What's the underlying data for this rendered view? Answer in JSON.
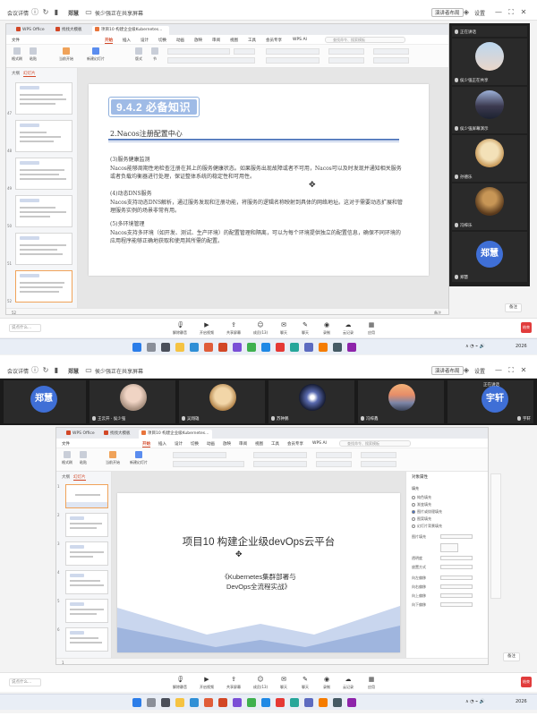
{
  "meeting": {
    "left_label": "会议详情",
    "host_name": "郑慧",
    "sharing_label": "侯少强正在共享屏幕",
    "speaker_view": "演讲者布局",
    "settings_label": "设置",
    "speaking_label": "正在讲话",
    "controls": [
      {
        "label": "解除静音",
        "icon": "mic-icon"
      },
      {
        "label": "开启视频",
        "icon": "camera-icon"
      },
      {
        "label": "共享屏幕",
        "icon": "share-icon"
      },
      {
        "label": "成员(13)",
        "icon": "members-icon"
      },
      {
        "label": "聊天",
        "icon": "chat-icon"
      },
      {
        "label": "聊天",
        "icon": "chat2-icon"
      },
      {
        "label": "应用",
        "icon": "apps-icon"
      },
      {
        "label": "录制",
        "icon": "record-icon"
      },
      {
        "label": "云记录",
        "icon": "cloud-icon"
      },
      {
        "label": "应用",
        "icon": "grid-icon"
      }
    ],
    "input_placeholder": "说点什么...",
    "end_label": "结束"
  },
  "wps": {
    "tabs": [
      "WPS Office",
      "找找大模板",
      "项目10 构建企业级Kubernetes..."
    ],
    "menus": [
      "文件",
      "开始",
      "插入",
      "设计",
      "切换",
      "动画",
      "放映",
      "审阅",
      "视图",
      "工具",
      "会员专享",
      "WPS AI"
    ],
    "active_menu": "开始",
    "search_placeholder": "查找命令、搜索模板",
    "ribbon": [
      "格式刷",
      "粘贴",
      "当前开始",
      "新建幻灯片",
      "版式",
      "节",
      "重置"
    ],
    "outline_tab": "大纲",
    "slide_tab": "幻灯片",
    "slide_numbers_1": [
      "47",
      "48",
      "49",
      "50",
      "51",
      "52"
    ],
    "slide_numbers_2": [
      "1",
      "2",
      "3",
      "4",
      "5",
      "6"
    ]
  },
  "slide1": {
    "title": "9.4.2 必备知识",
    "heading": "2.Nacos注册配置中心",
    "paragraphs": [
      {
        "head": "(3)服务健康监测",
        "body": "Nacos能够周期性地检查注册在其上的服务健康状态。如果服务出现故障或者不可用，Nacos可以及时发现并通知相关服务或者负载均衡器进行处理，保证整体系统的稳定性和可用性。"
      },
      {
        "head": "(4)动态DNS服务",
        "body": "Nacos支持动态DNS解析，通过服务发现和注册功能，将服务的逻辑名称映射到具体的网络地址。这对于需要动态扩展和管理服务实例的场景非常有用。"
      },
      {
        "head": "(5)多环境管理",
        "body": "Nacos支持多环境（如开发、测试、生产环境）的配置管理和隔离，可以为每个环境提供独立的配置信息，确保不同环境的应用程序能够正确地获取和使用其所需的配置。"
      }
    ]
  },
  "slide2": {
    "title": "项目10 构建企业级devOps云平台",
    "subtitle_line1": "《Kubernetes集群部署与",
    "subtitle_line2": "DevOps全流程实战》"
  },
  "participants_side": [
    {
      "name": "正在讲话"
    },
    {
      "name": "侯少强正在共享"
    },
    {
      "name": "侯少强屏幕演示"
    },
    {
      "name": "孙德乐"
    },
    {
      "name": "冯梓乐"
    },
    {
      "name": "郑慧"
    }
  ],
  "participants_top": [
    {
      "name": "郑慧",
      "avatar_text": "郑慧"
    },
    {
      "name": "王云开 · 侯少强"
    },
    {
      "name": "吴翔雄"
    },
    {
      "name": "苏钟鹏"
    },
    {
      "name": "冯梓鑫"
    },
    {
      "name": "宇轩",
      "avatar_text": "宇轩"
    }
  ],
  "side_avatar_text": "郑慧",
  "taskbar": {
    "time": "2026"
  },
  "notes_label": "备注",
  "panel2": {
    "title": "对象属性",
    "section": "填充",
    "options": [
      "纯色填充",
      "渐变填充",
      "图片或纹理填充",
      "图案填充",
      "幻灯片背景填充"
    ],
    "fields": [
      "图片填充",
      "透明度",
      "放置方式",
      "向左偏移",
      "向右偏移",
      "向上偏移",
      "向下偏移"
    ]
  }
}
